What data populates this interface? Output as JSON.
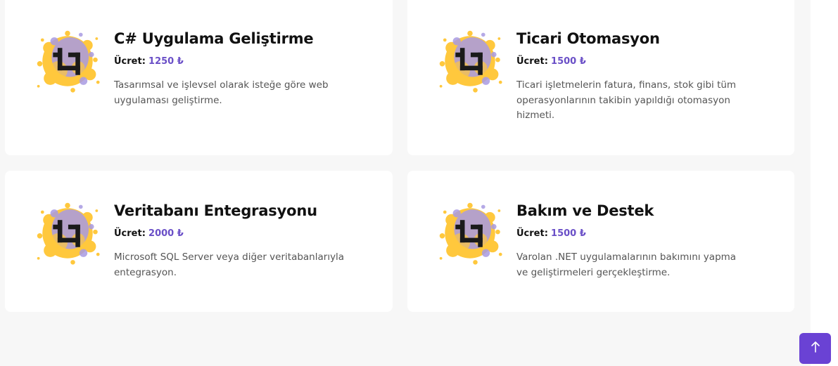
{
  "colors": {
    "accent": "#6a42d4",
    "price": "#6a4fc7",
    "splash_yellow": "#ffc83d",
    "splash_purple": "#a99be2"
  },
  "services": [
    {
      "title": "C# Uygulama Geliştirme",
      "price_label": "Ücret:",
      "price_value": "1250 ₺",
      "description": "Tasarımsal ve işlevsel olarak isteğe göre web uygulaması geliştirme.",
      "icon": "crop-icon"
    },
    {
      "title": "Ticari Otomasyon",
      "price_label": "Ücret:",
      "price_value": "1500 ₺",
      "description": "Ticari işletmelerin fatura, finans, stok gibi tüm operasyonlarının takibin yapıldığı otomasyon hizmeti.",
      "icon": "crop-icon"
    },
    {
      "title": "Veritabanı Entegrasyonu",
      "price_label": "Ücret:",
      "price_value": "2000 ₺",
      "description": "Microsoft SQL Server veya diğer veritabanlarıyla entegrasyon.",
      "icon": "crop-icon"
    },
    {
      "title": "Bakım ve Destek",
      "price_label": "Ücret:",
      "price_value": "1500 ₺",
      "description": "Varolan .NET uygulamalarının bakımını yapma ve geliştirmeleri gerçekleştirme.",
      "icon": "crop-icon"
    }
  ],
  "back_to_top": {
    "icon": "arrow-up-icon"
  }
}
